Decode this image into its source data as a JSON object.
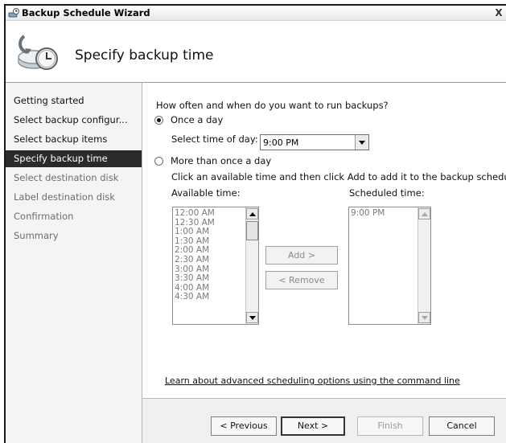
{
  "window": {
    "title": "Backup Schedule Wizard",
    "close_glyph": "X"
  },
  "header": {
    "page_title": "Specify backup time",
    "icon": "backup-clock-icon"
  },
  "sidebar": {
    "items": [
      {
        "label": "Getting started",
        "state": "done"
      },
      {
        "label": "Select backup configur...",
        "state": "done"
      },
      {
        "label": "Select backup items",
        "state": "done"
      },
      {
        "label": "Specify backup time",
        "state": "active"
      },
      {
        "label": "Select destination disk",
        "state": "pending"
      },
      {
        "label": "Label destination disk",
        "state": "pending"
      },
      {
        "label": "Confirmation",
        "state": "pending"
      },
      {
        "label": "Summary",
        "state": "pending"
      }
    ]
  },
  "main": {
    "question": "How often and when do you want to run backups?",
    "once_a_day": {
      "label": "Once a day",
      "selected": true
    },
    "time_of_day": {
      "label": "Select time of day:",
      "value": "9:00 PM"
    },
    "more_than_once": {
      "label": "More than once a day",
      "selected": false
    },
    "instruction": "Click an available time and then click Add to add it to the backup schedule.",
    "available": {
      "label": "Available time:",
      "items": [
        "12:00 AM",
        "12:30 AM",
        "1:00 AM",
        "1:30 AM",
        "2:00 AM",
        "2:30 AM",
        "3:00 AM",
        "3:30 AM",
        "4:00 AM",
        "4:30 AM"
      ]
    },
    "scheduled": {
      "label": "Scheduled time:",
      "items": [
        "9:00 PM"
      ]
    },
    "add_button": "Add >",
    "remove_button": "< Remove",
    "link": "Learn about advanced scheduling options using the command line"
  },
  "footer": {
    "previous": "< Previous",
    "next": "Next >",
    "finish": "Finish",
    "cancel": "Cancel"
  },
  "colors": {
    "active_nav_bg": "#2b2b2b",
    "sidebar_bg": "#f4f4f4",
    "footer_bg": "#f0f0f0"
  }
}
